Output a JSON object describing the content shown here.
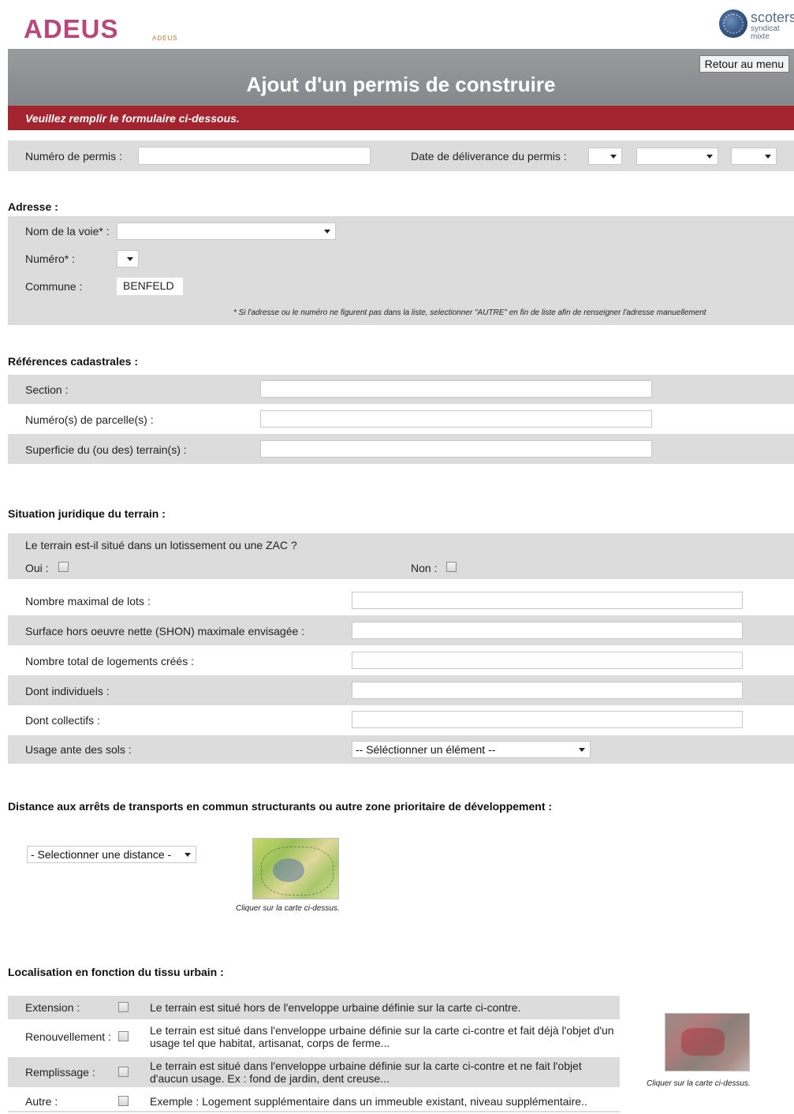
{
  "header": {
    "logo_text": "ADEUS",
    "logo_tagline": "ADEUS",
    "partner_name": "scoters",
    "partner_sub1": "syndicat",
    "partner_sub2": "mixte",
    "back_button": "Retour au menu",
    "page_title": "Ajout d'un permis de construire",
    "instruction": "Veuillez remplir le formulaire ci-dessous."
  },
  "permit": {
    "number_label": "Numéro de permis :",
    "date_label": "Date de déliverance du permis :"
  },
  "address": {
    "title": "Adresse :",
    "street_label": "Nom de la voie* :",
    "number_label": "Numéro* :",
    "commune_label": "Commune :",
    "commune_value": "BENFELD",
    "note": "* Si l'adresse ou le numéro ne figurent pas dans la liste, selectionner \"AUTRE\" en fin de liste afin de renseigner l'adresse manuellement"
  },
  "cadastral": {
    "title": "Références cadastrales :",
    "section_label": "Section :",
    "parcels_label": "Numéro(s) de parcelle(s) :",
    "area_label": "Superficie du (ou des) terrain(s) :"
  },
  "legal": {
    "title": "Situation juridique du terrain :",
    "question": "Le terrain est-il situé dans un lotissement ou une ZAC ?",
    "yes_label": "Oui :",
    "no_label": "Non :",
    "max_lots_label": "Nombre maximal de lots :",
    "shon_label": "Surface hors oeuvre nette (SHON) maximale envisagée :",
    "total_housing_label": "Nombre total de logements créés :",
    "individual_label": "Dont individuels :",
    "collective_label": "Dont collectifs :",
    "prior_use_label": "Usage ante des sols :",
    "prior_use_value": "-- Séléctionner un élément --"
  },
  "transport": {
    "title": "Distance aux arrêts de transports en commun structurants ou autre zone prioritaire de développement :",
    "distance_value": "- Selectionner une distance -",
    "map_caption": "Cliquer sur la carte ci-dessus."
  },
  "urban": {
    "title": "Localisation en fonction du tissu urbain :",
    "rows": [
      {
        "label": "Extension :",
        "text": "Le terrain est situé hors de l'enveloppe urbaine définie sur la carte ci-contre."
      },
      {
        "label": "Renouvellement :",
        "text": "Le terrain est situé dans l'enveloppe urbaine définie sur la carte ci-contre et fait déjà l'objet d'un usage tel que habitat, artisanat, corps de ferme..."
      },
      {
        "label": "Remplissage :",
        "text": "Le terrain est situé dans l'enveloppe urbaine définie sur la carte ci-contre et ne fait l'objet d'aucun usage. Ex : fond de jardin, dent creuse..."
      },
      {
        "label": "Autre :",
        "text": "Exemple : Logement supplémentaire dans un immeuble existant, niveau supplémentaire.."
      }
    ],
    "map_caption": "Cliquer sur la carte ci-dessus."
  },
  "colors": {
    "header_gray": "#8e8f92",
    "instruction_red": "#a3242f",
    "band_gray": "#dcdcdc"
  }
}
